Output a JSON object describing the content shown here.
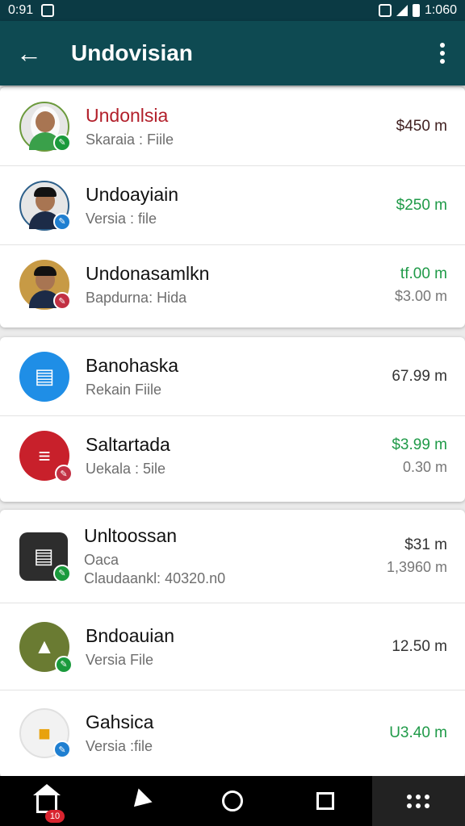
{
  "status_bar": {
    "time_left": "0:91",
    "time_right": "1:060",
    "icons": [
      "notification-icon",
      "wifi-icon",
      "signal-icon",
      "battery-icon"
    ]
  },
  "app_bar": {
    "title": "Undovisian",
    "back_icon": "arrow-left-icon",
    "more_icon": "more-vertical-icon"
  },
  "cards": [
    {
      "rows": [
        {
          "avatar": "person-veil-avatar",
          "title": "Undonlsia",
          "subtitle": "Skaraia : Fiile",
          "amount": "$450 m",
          "amount2": "",
          "badge": "green"
        },
        {
          "avatar": "person-cap-avatar",
          "title": "Undoayiain",
          "subtitle": "Versia : file",
          "amount": "$250 m",
          "amount2": "",
          "badge": "blue"
        },
        {
          "avatar": "person-cap2-avatar",
          "title": "Undonasamlkn",
          "subtitle": "Bapdurna: Hida",
          "amount": "tf.00 m",
          "amount2": "$3.00 m",
          "badge": "red"
        }
      ]
    },
    {
      "rows": [
        {
          "avatar": "chat-app-avatar",
          "title": "Banohaska",
          "subtitle": "Rekain Fiile",
          "amount": "67.99 m",
          "amount2": ""
        },
        {
          "avatar": "red-app-avatar",
          "title": "Saltartada",
          "subtitle": "Uekala : 5ile",
          "amount": "$3.99 m",
          "amount2": "0.30 m",
          "badge": "red"
        }
      ]
    },
    {
      "rows": [
        {
          "avatar": "dark-app-avatar",
          "title": "Unltoossan",
          "subtitle": "Oaca",
          "subtitle2": "Claudaankl: 40320.n0",
          "amount": "$31 m",
          "amount2": "1,3960 m",
          "badge": "green"
        },
        {
          "avatar": "nature-app-avatar",
          "title": "Bndoauian",
          "subtitle": "Versia File",
          "amount": "12.50 m",
          "amount2": "",
          "badge": "green"
        },
        {
          "avatar": "yellow-app-avatar",
          "title": "Gahsica",
          "subtitle": "Versia :file",
          "amount": "U3.40 m",
          "amount2": "",
          "badge": "blue"
        }
      ]
    }
  ],
  "nav_bar": {
    "home_badge": "10",
    "items": [
      "home-icon",
      "back-icon",
      "home-circle-icon",
      "recents-icon",
      "apps-grid-icon"
    ]
  }
}
